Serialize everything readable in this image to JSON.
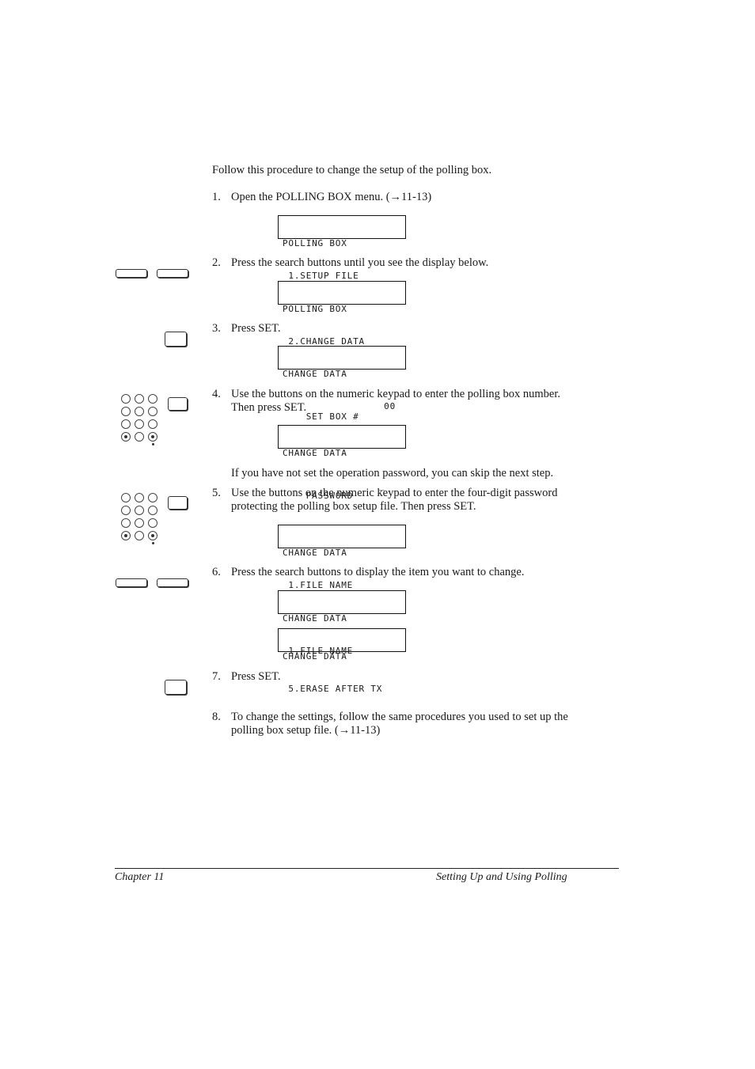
{
  "intro": "Follow this procedure to change the setup of the polling box.",
  "steps": [
    {
      "num": "1.",
      "lines": [
        "Open the POLLING BOX menu. (→11-13)"
      ]
    },
    {
      "num": "2.",
      "lines": [
        "Press the search buttons until you see the display below."
      ]
    },
    {
      "num": "3.",
      "lines": [
        "Press SET."
      ]
    },
    {
      "num": "4.",
      "lines": [
        "Use the buttons on the numeric keypad to enter the polling box number.",
        "Then press SET."
      ]
    },
    {
      "num": "5.",
      "lines": [
        "Use the buttons on the numeric keypad to enter the four-digit password",
        "protecting the polling box setup file. Then press SET."
      ]
    },
    {
      "num": "6.",
      "lines": [
        "Press the search buttons to display the item you want to change."
      ]
    },
    {
      "num": "7.",
      "lines": [
        "Press SET."
      ]
    },
    {
      "num": "8.",
      "lines": [
        "To change the settings, follow the same procedures you used to set up the",
        "polling box setup file. (→11-13)"
      ]
    }
  ],
  "note": "If you have not set the operation password, you can skip the next step.",
  "displays": [
    {
      "line1": "POLLING BOX",
      "line2": " 1.SETUP FILE"
    },
    {
      "line1": "POLLING BOX",
      "line2": " 2.CHANGE DATA"
    },
    {
      "line1": "CHANGE DATA",
      "line2": "SET BOX #",
      "value": "00"
    },
    {
      "line1": "CHANGE DATA",
      "line2": "PASSWORD",
      "cursor": "_"
    },
    {
      "line1": "CHANGE DATA",
      "line2": " 1.FILE NAME"
    },
    {
      "line1": "CHANGE DATA",
      "line2": " 1.FILE NAME"
    },
    {
      "line1": "CHANGE DATA",
      "line2": " 5.ERASE AFTER TX"
    }
  ],
  "footer": {
    "left": "Chapter 11",
    "right": "Setting Up and Using Polling"
  }
}
